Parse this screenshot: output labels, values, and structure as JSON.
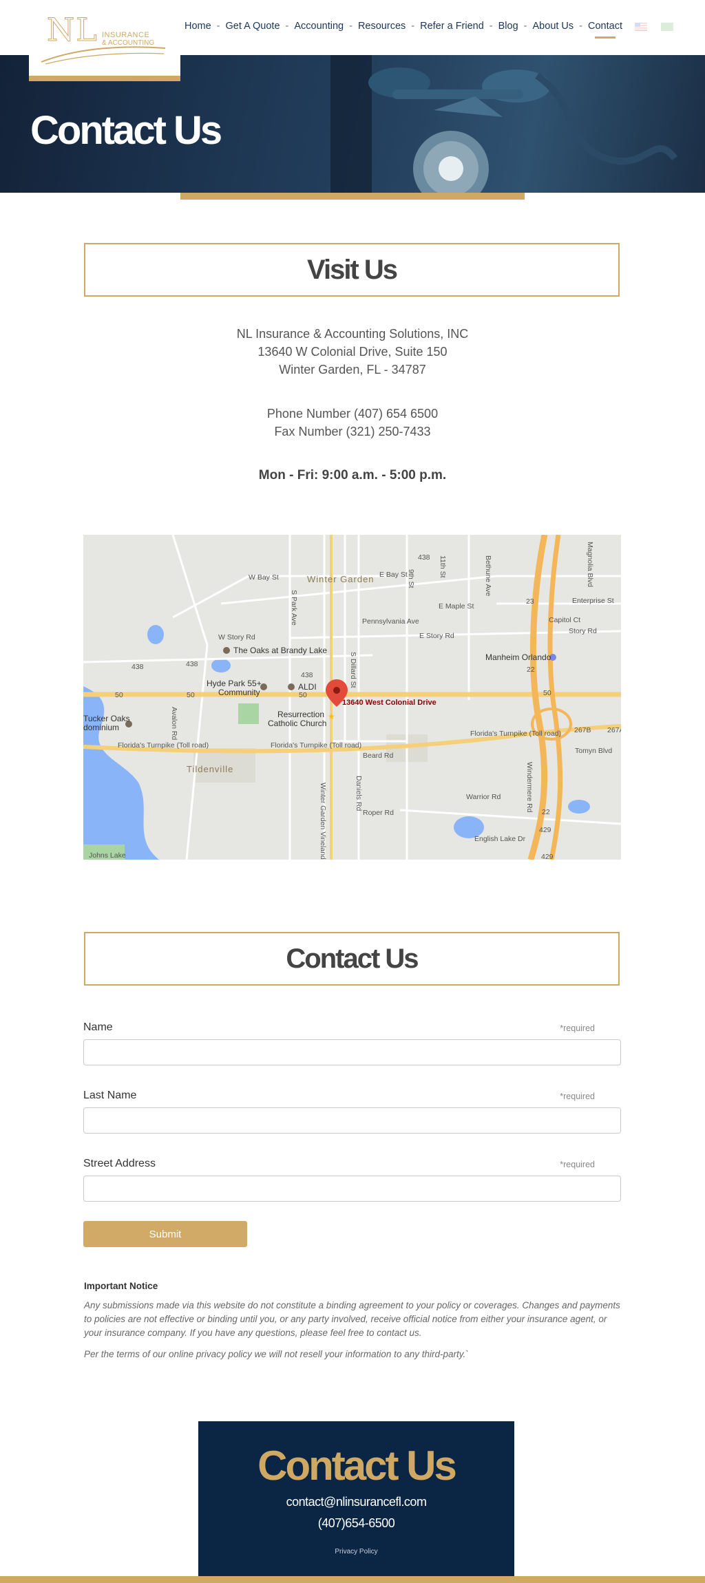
{
  "logo": {
    "letters": "NL",
    "line1": "INSURANCE",
    "line2": "& ACCOUNTING"
  },
  "nav": {
    "items": [
      "Home",
      "Get A Quote",
      "Accounting",
      "Resources",
      "Refer a Friend",
      "Blog",
      "About Us",
      "Contact"
    ],
    "separator": "-",
    "active": "Contact"
  },
  "languages": [
    "english-flag-icon",
    "spanish-flag-icon"
  ],
  "hero": {
    "title": "Contact Us"
  },
  "visit": {
    "title": "Visit Us",
    "company": "NL Insurance & Accounting Solutions, INC",
    "street": "13640 W Colonial Drive, Suite 150",
    "city": "Winter Garden, FL - 34787",
    "phone": "Phone Number (407) 654 6500",
    "fax": "Fax Number (321) 250-7433",
    "hours": "Mon - Fri: 9:00 a.m. - 5:00 p.m."
  },
  "map": {
    "pin_label": "13640  West Colonial Drive",
    "town": "Winter Garden",
    "labels": {
      "w_bay": "W Bay St",
      "e_bay": "E Bay St",
      "maple": "E Maple St",
      "story_w": "W Story Rd",
      "story_e": "E Story Rd",
      "story_c": "Story Rd",
      "penn": "Pennsylvania Ave",
      "enterprise": "Enterprise St",
      "capitol": "Capitol Ct",
      "oaks": "The Oaks at Brandy Lake",
      "manheim": "Manheim Orlando",
      "hyde": "Hyde Park 55+",
      "community": "Community",
      "aldi": "ALDI",
      "res1": "Resurrection",
      "res2": "Catholic Church",
      "tucker1": "Tucker Oaks",
      "tucker2": "dominium",
      "turnpike1": "Florida's Turnpike (Toll road)",
      "turnpike2": "Florida's Turnpike (Toll road)",
      "turnpike3": "Florida's Turnpike (Toll road)",
      "tildenville": "Tildenville",
      "beard": "Beard Rd",
      "warrior": "Warrior Rd",
      "roper": "Roper Rd",
      "tomyn": "Tomyn Blvd",
      "johns": "Johns Lake",
      "english": "English Lake Dr",
      "ninth": "9th St",
      "eleventh": "11th St",
      "park": "S Park Ave",
      "avalon": "Avalon Rd",
      "dillard": "S Dillard St",
      "daniels": "Daniels Rd",
      "vineland": "Winter Garden Vineland Rd",
      "bethune": "Bethune Ave",
      "windermere": "Windermere Rd",
      "magnolia": "Magnolia Blvd",
      "r438a": "438",
      "r438b": "438",
      "r438c": "438",
      "r438d": "438",
      "r50a": "50",
      "r50b": "50",
      "r50c": "50",
      "r50d": "50",
      "r429a": "429",
      "r429b": "429",
      "r22a": "22",
      "r22b": "22",
      "r23": "23",
      "r267b": "267B",
      "r267a": "267A"
    }
  },
  "contact_form": {
    "title": "Contact Us",
    "fields": [
      {
        "label": "Name",
        "required": "*required",
        "value": ""
      },
      {
        "label": "Last Name",
        "required": "*required",
        "value": ""
      },
      {
        "label": "Street Address",
        "required": "*required",
        "value": ""
      }
    ],
    "submit": "Submit"
  },
  "notice": {
    "title": "Important Notice",
    "p1": "Any submissions made via this website do not constitute a binding agreement to your policy or coverages. Changes and payments to policies are not effective or binding until you, or any party involved, receive official notice from either your insurance agent, or your insurance company. If you have any questions, please feel free to contact us.",
    "p2": "Per the terms of our online privacy policy we will not resell your information to any third-party.`"
  },
  "footer": {
    "title": "Contact Us",
    "email": "contact@nlinsurancefl.com",
    "phone": "(407)654-6500",
    "privacy": "Privacy Policy"
  },
  "colors": {
    "gold": "#cfa863",
    "navy": "#0b2545",
    "nav_text": "#1d3557"
  }
}
